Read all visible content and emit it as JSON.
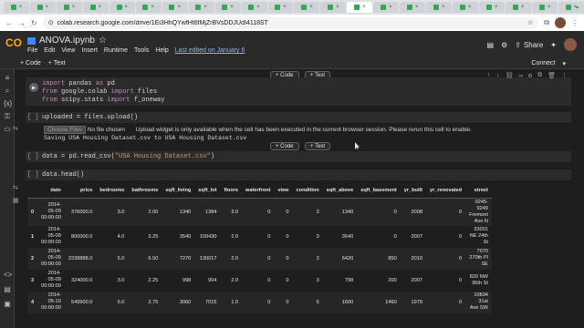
{
  "browser": {
    "url": "colab.research.google.com/drive/1Ei3HhQYwfHt6fMjZrBVsDDJUdI4118ST",
    "tab_count": 22
  },
  "header": {
    "logo": "CO",
    "notebook_title": "ANOVA.ipynb",
    "menu": [
      "File",
      "Edit",
      "View",
      "Insert",
      "Runtime",
      "Tools",
      "Help"
    ],
    "last_edited": "Last edited on January 6",
    "share_label": "Share"
  },
  "toolbar": {
    "add_code": "+ Code",
    "add_text": "+ Text",
    "connect": "Connect"
  },
  "add_buttons": {
    "code": "+ Code",
    "text": "+ Text"
  },
  "cells": {
    "c1": {
      "l1": "import pandas as pd",
      "l2": "from google.colab import files",
      "l3": "from scipy.stats import f_oneway"
    },
    "c2": {
      "prompt": "[ ]",
      "code": "uploaded = files.upload()"
    },
    "c2_output": {
      "choose": "Choose Files",
      "nofile": "No file chosen",
      "msg": "Upload widget is only available when the cell has been executed in the current browser session. Please rerun this cell to enable.",
      "saving": "Saving USA Housing Dataset.csv to USA Housing Dataset.csv"
    },
    "c3": {
      "prompt": "[ ]",
      "code_pre": "data = pd.read_csv(",
      "code_str": "\"USA Housing Dataset.csv\"",
      "code_post": ")"
    },
    "c4": {
      "prompt": "[ ]",
      "code": "data.head()"
    }
  },
  "table": {
    "columns": [
      "",
      "date",
      "price",
      "bedrooms",
      "bathrooms",
      "sqft_living",
      "sqft_lot",
      "floors",
      "waterfront",
      "view",
      "condition",
      "sqft_above",
      "sqft_basement",
      "yr_built",
      "yr_renovated",
      "street"
    ],
    "rows": [
      [
        "0",
        "2014-05-09 00:00:00",
        "376000.0",
        "3.0",
        "2.00",
        "1340",
        "1384",
        "3.0",
        "0",
        "0",
        "3",
        "1340",
        "0",
        "2008",
        "0",
        "9245-9249 Fremont Ave N"
      ],
      [
        "1",
        "2014-05-09 00:00:00",
        "800000.0",
        "4.0",
        "3.25",
        "3540",
        "159430",
        "2.0",
        "0",
        "0",
        "3",
        "3540",
        "0",
        "2007",
        "0",
        "33001 NE 24th St"
      ],
      [
        "2",
        "2014-05-09 00:00:00",
        "2238888.0",
        "5.0",
        "6.50",
        "7270",
        "130017",
        "2.0",
        "0",
        "0",
        "3",
        "6420",
        "850",
        "2010",
        "0",
        "7070 270th Pl SE"
      ],
      [
        "3",
        "2014-05-09 00:00:00",
        "324000.0",
        "3.0",
        "2.25",
        "998",
        "904",
        "2.0",
        "0",
        "0",
        "3",
        "798",
        "200",
        "2007",
        "0",
        "820 NW 95th St"
      ],
      [
        "4",
        "2014-05-10 00:00:00",
        "549900.0",
        "5.0",
        "2.75",
        "3060",
        "7015",
        "1.0",
        "0",
        "0",
        "5",
        "1600",
        "1460",
        "1979",
        "0",
        "10834 31st Ave SW"
      ]
    ]
  }
}
